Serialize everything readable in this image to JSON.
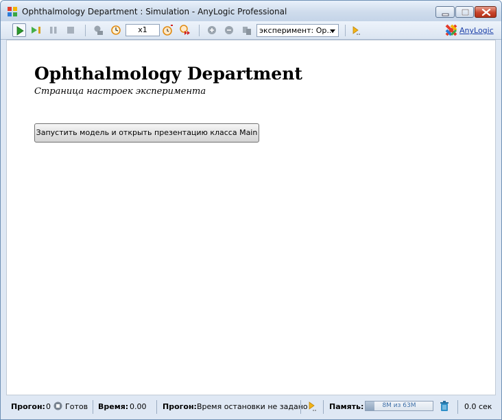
{
  "window": {
    "title": "Ophthalmology Department : Simulation - AnyLogic Professional"
  },
  "toolbar": {
    "speed_value": "x1",
    "experiment_select": "эксперимент: Op...",
    "anylogic_link": "AnyLogic",
    "icons": [
      "run-icon",
      "step-icon",
      "pause-icon",
      "stop-icon",
      "model-time-icon",
      "clock-icon",
      "slower-icon",
      "faster-icon",
      "zoom-in-icon",
      "zoom-out-icon",
      "navigate-icon",
      "experiment-icon"
    ]
  },
  "main": {
    "title": "Ophthalmology Department",
    "subtitle": "Страница настроек эксперимента",
    "run_button_label": "Запустить модель и открыть презентацию класса Main"
  },
  "status": {
    "run_label": "Прогон:",
    "run_value": "0",
    "state_text": "Готов",
    "time_label": "Время:",
    "time_value": "0.00",
    "run2_label": "Прогон:",
    "stop_text": "Время остановки не задано",
    "memory_label": "Память:",
    "memory_text": "8M из 63M",
    "memory_fraction": 0.13,
    "elapsed": "0.0 сек"
  },
  "colors": {
    "window_border": "#6d8fb4",
    "chrome_bg": "#dfe8f4",
    "link": "#1a3ea8",
    "run_green": "#2c9a2c"
  }
}
